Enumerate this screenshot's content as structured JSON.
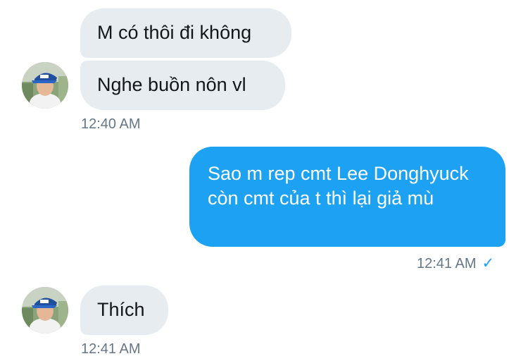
{
  "messages": [
    {
      "direction": "incoming",
      "text": "M có thôi đi không"
    },
    {
      "direction": "incoming",
      "text": "Nghe buồn nôn vl"
    },
    {
      "direction": "incoming_timestamp",
      "text": "12:40 AM"
    },
    {
      "direction": "outgoing",
      "text": "Sao m rep cmt Lee Donghyuck còn cmt của t thì lại giả mù"
    },
    {
      "direction": "outgoing_timestamp",
      "text": "12:41 AM",
      "status_icon": "checkmark-icon"
    },
    {
      "direction": "incoming",
      "text": "Thích"
    },
    {
      "direction": "incoming_timestamp",
      "text": "12:41 AM"
    }
  ],
  "colors": {
    "incoming_bubble": "#e6ecf0",
    "outgoing_bubble": "#1da1f2",
    "timestamp": "#657786",
    "check": "#1da1f2"
  },
  "read_receipt_glyph": "✓"
}
